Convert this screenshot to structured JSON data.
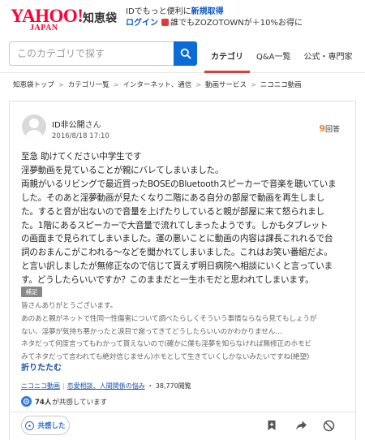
{
  "header": {
    "logo_main": "YAHOO!",
    "logo_sub": "JAPAN",
    "service_name": "知恵袋",
    "promo_line1_prefix": "IDでもっと便利に",
    "promo_line1_link": "新規取得",
    "promo_login": "ログイン",
    "promo_line2_text": "誰でもZOZOTOWNが＋10%お得に"
  },
  "search": {
    "placeholder": "このカテゴリで探す"
  },
  "nav": {
    "tabs": [
      "カテゴリ",
      "Q&A一覧",
      "公式・専門家"
    ]
  },
  "breadcrumb": [
    "知恵袋トップ",
    "カテゴリ一覧",
    "インターネット、通信",
    "動画サービス",
    "ニコニコ動画"
  ],
  "question": {
    "user_name": "ID非公開",
    "user_suffix": "さん",
    "date": "2016/8/18 17:10",
    "answer_count": "9",
    "answer_count_unit": "回答",
    "body": [
      "至急 助けてください中学生です",
      "淫夢動画を見ていることが親にバレてしまいました。",
      "両親がいるリビングで最近買ったBOSEのBluetoothスピーカーで音楽を聴いていま",
      "した。そのあと淫夢動画が見たくなり二階にある自分の部屋で動画を再生しまし",
      "た。すると音が出ないので音量を上げたりしていると親が部屋に来て怒られまし",
      "た。1階にあるスピーカーで大音量で流れてしまったようです。しかもタブレット",
      "の画面まで見られてしまいました。運の悪いことに動画の内容は課長これれるで台",
      "詞のおまんこがこわれる～などを聞かれてしまいました。これはお笑い番組だよ。",
      "と言い訳しましたが無修正なので信じて貰えず明日病院へ相談にいくと言っていま",
      "す。どうしたらいいですか？このままだと一生ホモだと思われてしまいます。"
    ],
    "supplement_label": "補足",
    "supplement": [
      "皆さんありがとうございます。",
      "あのあと親がネットで性同一性傷害について調べたらしくそういう事情ならなら見てもしょうが",
      "ない、淫夢が気持ち悪かったと涙目で謝ってきてどうしたらいいのかわかりません…",
      "ネタだって何度言ってもわかって貰えないので(確かに僕も淫夢を知らなければ無修正のホモビ",
      "みてネタだって言われても絶対信じません)ホモとして生きていくしかないみたいですね(絶望)"
    ],
    "collapse_label": "折りたたむ",
    "tag_category": "ニコニコ動画",
    "tag_related": "恋愛相談、人間関係の悩み",
    "views": "38,770閲覧",
    "empathy_count": "74人",
    "empathy_suffix": "が共感しています",
    "empathize_button": "共感した"
  },
  "colors": {
    "brand_red": "#ff0033",
    "accent_blue": "#0b6cd8",
    "answer_orange": "#e8833a",
    "tab_underline": "#e23b3b"
  }
}
